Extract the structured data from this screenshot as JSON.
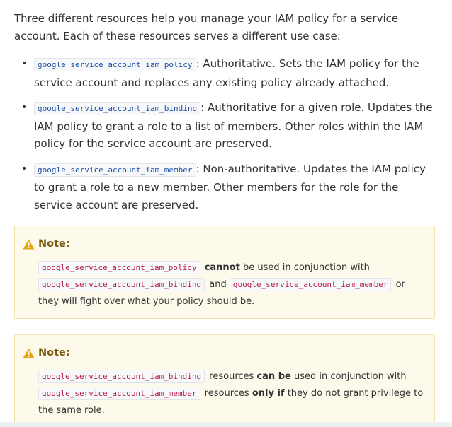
{
  "intro": "Three different resources help you manage your IAM policy for a service account. Each of these resources serves a different use case:",
  "resources": [
    {
      "code": "google_service_account_iam_policy",
      "desc": ": Authoritative. Sets the IAM policy for the service account and replaces any existing policy already attached."
    },
    {
      "code": "google_service_account_iam_binding",
      "desc": ": Authoritative for a given role. Updates the IAM policy to grant a role to a list of members. Other roles within the IAM policy for the service account are preserved."
    },
    {
      "code": "google_service_account_iam_member",
      "desc": ": Non-authoritative. Updates the IAM policy to grant a role to a new member. Other members for the role for the service account are preserved."
    }
  ],
  "bullet_glyph": "•",
  "note1": {
    "title": "Note:",
    "code1": "google_service_account_iam_policy",
    "bold1": "cannot",
    "text1": " be used in conjunction with",
    "code2": "google_service_account_iam_binding",
    "text2": " and ",
    "code3": "google_service_account_iam_member",
    "text3": " or they will fight over what your policy should be."
  },
  "note2": {
    "title": "Note:",
    "code1": "google_service_account_iam_binding",
    "text1": " resources ",
    "bold1": "can be",
    "text2": " used in conjunction with",
    "code2": "google_service_account_iam_member",
    "text3": " resources ",
    "bold2": "only if",
    "text4": " they do not grant privilege to the same role."
  },
  "colors": {
    "note_bg": "#fdfaeb",
    "warning": "#e3a810",
    "code_blue": "#1a4ea8",
    "code_pink": "#b3194a"
  },
  "icons": {
    "note": "warning-icon"
  }
}
